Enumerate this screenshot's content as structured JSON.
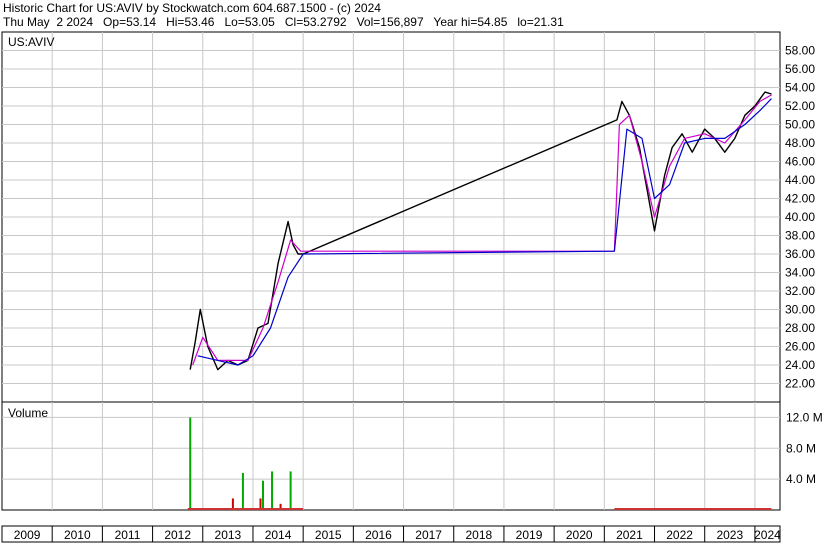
{
  "header": {
    "line1": "Historic Chart for US:AVIV by Stockwatch.com 604.687.1500 - (c) 2024",
    "line2": "Thu May  2 2024   Op=53.14   Hi=53.46   Lo=53.05   Cl=53.2792   Vol=156,897   Year hi=54.85   lo=21.31"
  },
  "chart_data": [
    {
      "type": "line",
      "title": "US:AVIV",
      "ylim": [
        20,
        60
      ],
      "y_ticks": [
        "22.00",
        "24.00",
        "26.00",
        "28.00",
        "30.00",
        "32.00",
        "34.00",
        "36.00",
        "38.00",
        "40.00",
        "42.00",
        "44.00",
        "46.00",
        "48.00",
        "50.00",
        "52.00",
        "54.00",
        "56.00",
        "58.00"
      ],
      "grid": true,
      "series": [
        {
          "color": "#000000",
          "x": [
            2012.75,
            2012.85,
            2012.95,
            2013.1,
            2013.3,
            2013.5,
            2013.7,
            2013.9,
            2014.1,
            2014.3,
            2014.5,
            2014.7,
            2014.8,
            2014.9,
            2015.0,
            2021.25,
            2021.35,
            2021.5,
            2021.7,
            2021.85,
            2022.0,
            2022.2,
            2022.35,
            2022.55,
            2022.75,
            2023.0,
            2023.2,
            2023.4,
            2023.6,
            2023.8,
            2024.0,
            2024.2,
            2024.33
          ],
          "values": [
            23.5,
            26.5,
            30.0,
            26.0,
            23.5,
            24.5,
            24.0,
            24.5,
            28.0,
            28.5,
            35.0,
            39.5,
            37.0,
            36.0,
            36.0,
            50.5,
            52.5,
            51.0,
            47.5,
            43.0,
            38.5,
            44.5,
            47.5,
            49.0,
            47.0,
            49.5,
            48.5,
            47.0,
            48.5,
            51.0,
            52.0,
            53.5,
            53.3
          ]
        },
        {
          "color": "#cc00cc",
          "x": [
            2012.8,
            2013.0,
            2013.3,
            2013.6,
            2013.9,
            2014.2,
            2014.5,
            2014.75,
            2014.95,
            2021.2,
            2021.3,
            2021.5,
            2021.75,
            2022.0,
            2022.3,
            2022.6,
            2023.0,
            2023.4,
            2023.8,
            2024.1,
            2024.33
          ],
          "values": [
            24.0,
            27.0,
            24.5,
            24.5,
            24.5,
            28.0,
            33.0,
            37.5,
            36.3,
            36.3,
            50.0,
            51.0,
            46.0,
            40.0,
            45.5,
            48.5,
            49.0,
            48.0,
            50.5,
            52.5,
            53.2
          ]
        },
        {
          "color": "#0000cc",
          "x": [
            2012.9,
            2013.3,
            2013.7,
            2014.0,
            2014.35,
            2014.7,
            2015.0,
            2021.2,
            2021.45,
            2021.75,
            2022.0,
            2022.3,
            2022.6,
            2023.0,
            2023.4,
            2023.8,
            2024.1,
            2024.33
          ],
          "values": [
            25.0,
            24.5,
            24.0,
            25.0,
            28.0,
            33.5,
            36.0,
            36.3,
            49.5,
            48.5,
            42.0,
            43.5,
            48.0,
            48.5,
            48.5,
            50.0,
            51.5,
            52.8
          ]
        }
      ]
    },
    {
      "type": "bar",
      "title": "Volume",
      "ylim": [
        0,
        14000000
      ],
      "y_ticks": [
        "4.0 M",
        "8.0 M",
        "12.0 M"
      ],
      "bars": [
        {
          "x": 2012.75,
          "value": 12000000,
          "color": "#00aa00"
        },
        {
          "x": 2013.8,
          "value": 4800000,
          "color": "#00aa00"
        },
        {
          "x": 2014.2,
          "value": 3800000,
          "color": "#00aa00"
        },
        {
          "x": 2014.38,
          "value": 5000000,
          "color": "#00aa00"
        },
        {
          "x": 2014.75,
          "value": 5000000,
          "color": "#00aa00"
        },
        {
          "x": 2013.6,
          "value": 1500000,
          "color": "#cc0000"
        },
        {
          "x": 2014.15,
          "value": 1500000,
          "color": "#cc0000"
        },
        {
          "x": 2014.55,
          "value": 800000,
          "color": "#cc0000"
        }
      ]
    }
  ],
  "x_axis": {
    "range": [
      2009,
      2024.5
    ],
    "labels": [
      "2009",
      "2010",
      "2011",
      "2012",
      "2013",
      "2014",
      "2015",
      "2016",
      "2017",
      "2018",
      "2019",
      "2020",
      "2021",
      "2022",
      "2023",
      "2024"
    ]
  }
}
